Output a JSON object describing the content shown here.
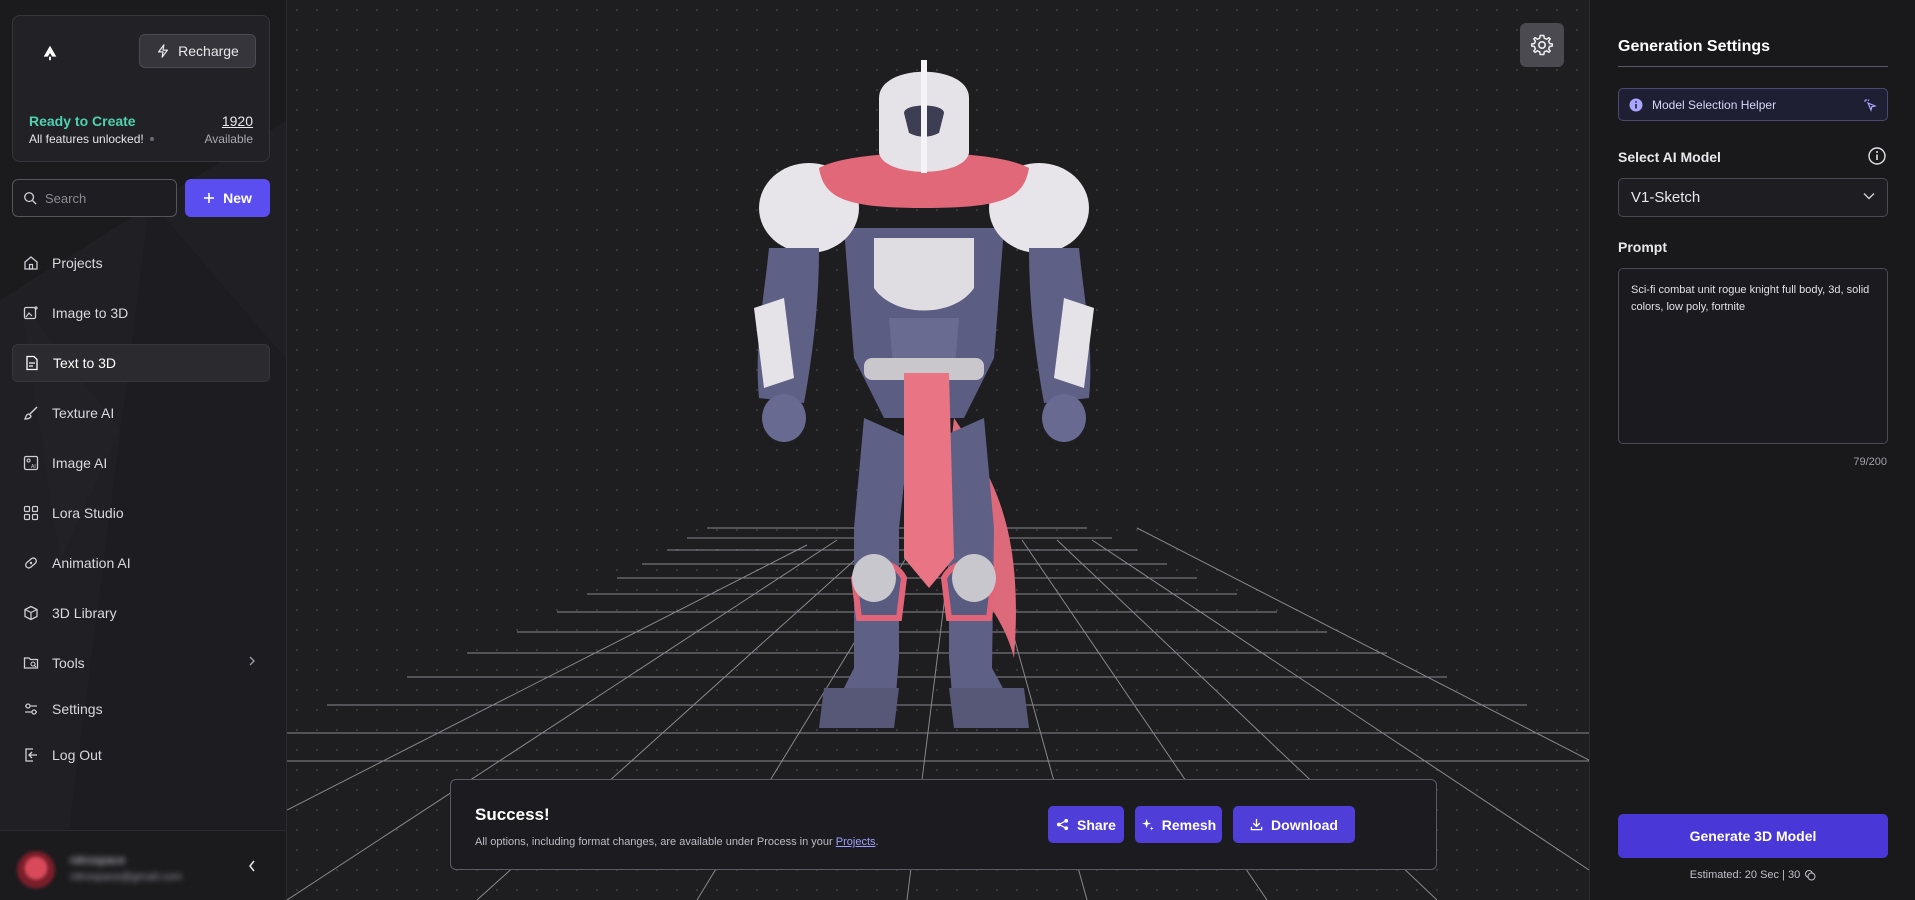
{
  "sidebar": {
    "account": {
      "recharge_label": "Recharge",
      "status_title": "Ready to Create",
      "status_sub": "All features unlocked!",
      "credits": "1920",
      "credits_label": "Available"
    },
    "search": {
      "placeholder": "Search"
    },
    "new_label": "New",
    "items": [
      {
        "label": "Projects",
        "icon": "home-icon"
      },
      {
        "label": "Image to 3D",
        "icon": "image-plus-icon"
      },
      {
        "label": "Text to 3D",
        "icon": "document-icon",
        "active": true
      },
      {
        "label": "Texture AI",
        "icon": "brush-icon"
      },
      {
        "label": "Image AI",
        "icon": "image-ai-icon"
      },
      {
        "label": "Lora Studio",
        "icon": "grid-icon"
      },
      {
        "label": "Animation AI",
        "icon": "animation-icon"
      },
      {
        "label": "3D Library",
        "icon": "cube-icon"
      },
      {
        "label": "Tools",
        "icon": "folder-search-icon"
      },
      {
        "label": "Settings",
        "icon": "sliders-icon"
      },
      {
        "label": "Log Out",
        "icon": "logout-icon"
      }
    ],
    "user": {
      "name": "nitrospace",
      "email": "nitrospace@gmail.com"
    }
  },
  "viewport": {
    "toast": {
      "title": "Success!",
      "text_before": "All options, including format changes, are available under Process in your ",
      "link": "Projects",
      "text_after": ".",
      "share_label": "Share",
      "remesh_label": "Remesh",
      "download_label": "Download"
    }
  },
  "panel": {
    "title": "Generation Settings",
    "helper_label": "Model Selection Helper",
    "model_label": "Select AI Model",
    "model_value": "V1-Sketch",
    "prompt_label": "Prompt",
    "prompt_value": "Sci-fi combat unit rogue knight full body, 3d, solid colors, low poly, fortnite",
    "counter": "79/200",
    "generate_label": "Generate 3D Model",
    "estimate": "Estimated: 20 Sec | 30"
  },
  "colors": {
    "accent": "#5b4ef0",
    "button": "#4f3fd8",
    "ready_green": "#4fd1b0",
    "background": "#1c1c1f"
  }
}
